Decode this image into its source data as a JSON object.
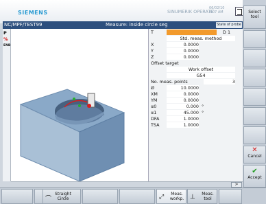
{
  "header": {
    "brand": "SIEMENS",
    "product": "SINUMERIK OPERATE",
    "date": "06/02/10",
    "time": "4:07 AM"
  },
  "pathbar": {
    "program_path": "NC/MPF/TEST99",
    "title": "Measure: inside circle seg",
    "badge": "State of probe"
  },
  "leftcol": [
    "P",
    "%",
    "ENB"
  ],
  "panel": {
    "T_label": "T",
    "T_value": "",
    "D_label": "D 1",
    "method": "Std. meas. method",
    "x_label": "X",
    "x_val": "0.0000",
    "y_label": "Y",
    "y_val": "0.0000",
    "z_label": "Z",
    "z_val": "0.0000",
    "offset_target_label": "Offset target",
    "offset_target_val": "Work offset",
    "offset_id": "G54",
    "num_points_label": "No. meas. points",
    "num_points_val": "3",
    "dia_label": "Ø",
    "dia_val": "10.0000",
    "xm_label": "XM",
    "xm_val": "0.0000",
    "ym_label": "YM",
    "ym_val": "0.0000",
    "a0_label": "α0",
    "a0_val": "0.000",
    "a0_unit": "°",
    "a1_label": "α1",
    "a1_val": "45.000",
    "a1_unit": "°",
    "dfa_label": "DFA",
    "dfa_val": "1.0000",
    "tsa_label": "TSA",
    "tsa_val": "1.0000"
  },
  "right_softkeys": {
    "select_tool": "Select tool",
    "cancel": "Cancel",
    "accept": "Accept"
  },
  "bottom_softkeys": {
    "straight_circle": "Straight Circle",
    "meas_workp": "Meas. workp.",
    "meas_tool": "Meas. tool"
  },
  "scrollbar": {
    "arrow": ">"
  },
  "colors": {
    "highlight": "#f29a2c",
    "pathbar": "#2d4f7e",
    "brand": "#2a9bd2"
  }
}
